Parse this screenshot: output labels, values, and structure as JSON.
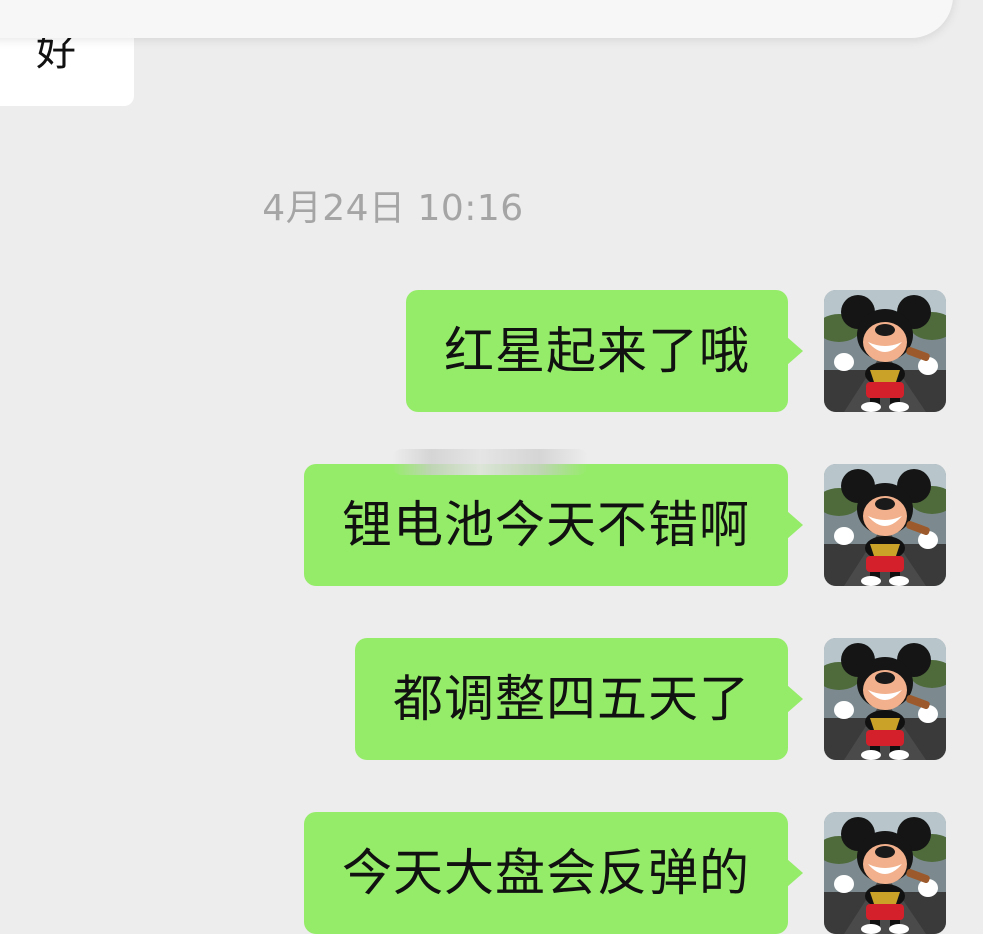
{
  "incoming": {
    "text": "好"
  },
  "timestamp": "4月24日 10:16",
  "messages": [
    {
      "text": "红星起来了哦",
      "avatar_icon": "mickey-avatar-icon"
    },
    {
      "text": "锂电池今天不错啊",
      "avatar_icon": "mickey-avatar-icon"
    },
    {
      "text": "都调整四五天了",
      "avatar_icon": "mickey-avatar-icon"
    },
    {
      "text": "今天大盘会反弹的",
      "avatar_icon": "mickey-avatar-icon"
    }
  ],
  "colors": {
    "background": "#ededed",
    "outgoing_bubble": "#95ec69",
    "incoming_bubble": "#ffffff",
    "timestamp_text": "#a5a5a5"
  }
}
